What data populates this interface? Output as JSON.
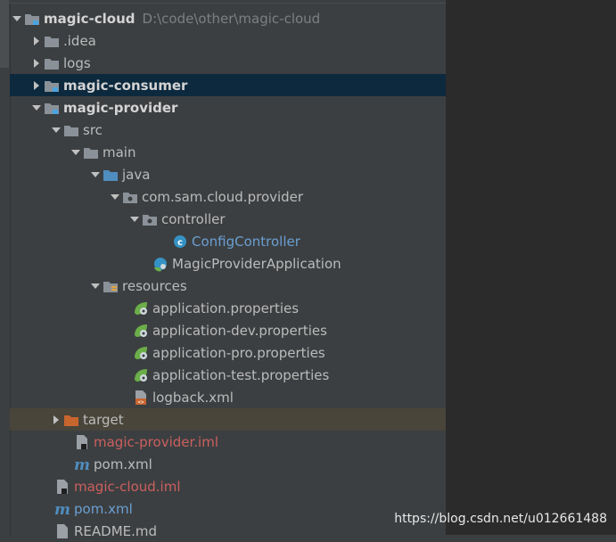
{
  "project_tree": {
    "root": {
      "label": "magic-cloud",
      "path": "D:\\code\\other\\magic-cloud"
    },
    "items": [
      {
        "label": ".idea"
      },
      {
        "label": "logs"
      },
      {
        "label": "magic-consumer"
      },
      {
        "label": "magic-provider"
      },
      {
        "label": "src"
      },
      {
        "label": "main"
      },
      {
        "label": "java"
      },
      {
        "label": "com.sam.cloud.provider"
      },
      {
        "label": "controller"
      },
      {
        "label": "ConfigController"
      },
      {
        "label": "MagicProviderApplication"
      },
      {
        "label": "resources"
      },
      {
        "label": "application.properties"
      },
      {
        "label": "application-dev.properties"
      },
      {
        "label": "application-pro.properties"
      },
      {
        "label": "application-test.properties"
      },
      {
        "label": "logback.xml"
      },
      {
        "label": "target"
      },
      {
        "label": "magic-provider.iml"
      },
      {
        "label": "pom.xml"
      },
      {
        "label": "magic-cloud.iml"
      },
      {
        "label": "pom.xml"
      },
      {
        "label": "README.md"
      }
    ]
  },
  "watermark": "https://blog.csdn.net/u012661488",
  "colors": {
    "selection": "#0d293e",
    "excluded": "#49453a",
    "folder": "#8a9199",
    "source_folder": "#4f8dbf",
    "excluded_folder": "#c7652e",
    "spring": "#6bae4a"
  }
}
